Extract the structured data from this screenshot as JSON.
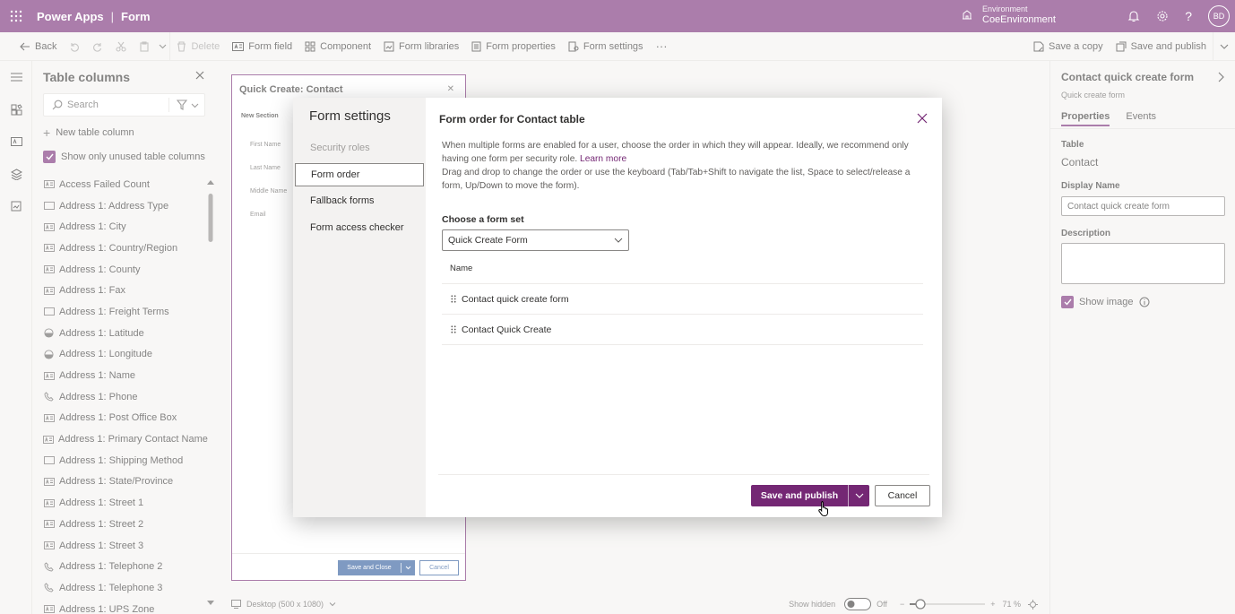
{
  "app": {
    "name": "Power Apps",
    "separator": "|",
    "page": "Form"
  },
  "environment": {
    "label": "Environment",
    "name": "CoeEnvironment"
  },
  "user": {
    "initials": "BD"
  },
  "commandbar": {
    "back": "Back",
    "delete": "Delete",
    "form_field": "Form field",
    "component": "Component",
    "form_libraries": "Form libraries",
    "form_properties": "Form properties",
    "form_settings": "Form settings",
    "more": "···",
    "save_copy": "Save a copy",
    "save_publish": "Save and publish"
  },
  "left_panel": {
    "title": "Table columns",
    "search_placeholder": "Search",
    "new_column": "New table column",
    "show_unused": "Show only unused table columns",
    "columns": [
      {
        "label": "Access Failed Count",
        "icon": "text-icon"
      },
      {
        "label": "Address 1: Address Type",
        "icon": "choice-icon"
      },
      {
        "label": "Address 1: City",
        "icon": "text-icon"
      },
      {
        "label": "Address 1: Country/Region",
        "icon": "text-icon"
      },
      {
        "label": "Address 1: County",
        "icon": "text-icon"
      },
      {
        "label": "Address 1: Fax",
        "icon": "text-icon"
      },
      {
        "label": "Address 1: Freight Terms",
        "icon": "choice-icon"
      },
      {
        "label": "Address 1: Latitude",
        "icon": "float-icon"
      },
      {
        "label": "Address 1: Longitude",
        "icon": "float-icon"
      },
      {
        "label": "Address 1: Name",
        "icon": "text-icon"
      },
      {
        "label": "Address 1: Phone",
        "icon": "phone-icon"
      },
      {
        "label": "Address 1: Post Office Box",
        "icon": "text-icon"
      },
      {
        "label": "Address 1: Primary Contact Name",
        "icon": "text-icon"
      },
      {
        "label": "Address 1: Shipping Method",
        "icon": "choice-icon"
      },
      {
        "label": "Address 1: State/Province",
        "icon": "text-icon"
      },
      {
        "label": "Address 1: Street 1",
        "icon": "text-icon"
      },
      {
        "label": "Address 1: Street 2",
        "icon": "text-icon"
      },
      {
        "label": "Address 1: Street 3",
        "icon": "text-icon"
      },
      {
        "label": "Address 1: Telephone 2",
        "icon": "phone-icon"
      },
      {
        "label": "Address 1: Telephone 3",
        "icon": "phone-icon"
      },
      {
        "label": "Address 1: UPS Zone",
        "icon": "text-icon"
      }
    ]
  },
  "form_preview": {
    "title": "Quick Create: Contact",
    "section": "New Section",
    "fields": [
      "First Name",
      "Last Name",
      "Middle Name",
      "Email"
    ],
    "save_close": "Save and Close",
    "cancel": "Cancel"
  },
  "status_bar": {
    "device": "Desktop (500 x 1080)",
    "show_hidden": "Show hidden",
    "toggle_state": "Off",
    "zoom": "71 %"
  },
  "right_panel": {
    "title": "Contact quick create form",
    "subtitle": "Quick create form",
    "tabs": [
      "Properties",
      "Events"
    ],
    "table_label": "Table",
    "table_value": "Contact",
    "display_name_label": "Display Name",
    "display_name_value": "Contact quick create form",
    "description_label": "Description",
    "show_image": "Show image"
  },
  "dialog": {
    "nav_title": "Form settings",
    "nav_items": [
      "Security roles",
      "Form order",
      "Fallback forms",
      "Form access checker"
    ],
    "title": "Form order for Contact table",
    "desc_1": "When multiple forms are enabled for a user, choose the order in which they will appear. Ideally, we recommend only having one form per security role.",
    "learn_more": "Learn more",
    "desc_2": "Drag and drop to change the order or use the keyboard (Tab/Tab+Shift to navigate the list, Space to select/release a form, Up/Down to move the form).",
    "form_set_label": "Choose a form set",
    "form_set_value": "Quick Create Form",
    "column_header": "Name",
    "rows": [
      "Contact quick create form",
      "Contact Quick Create"
    ],
    "save_publish": "Save and publish",
    "cancel": "Cancel"
  },
  "colors": {
    "brand": "#742774",
    "preview_button": "#2b579a"
  }
}
